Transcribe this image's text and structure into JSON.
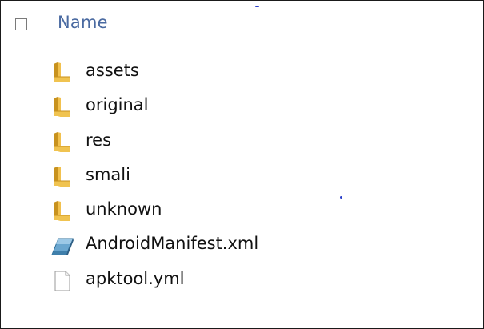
{
  "header": {
    "column_name": "Name"
  },
  "items": [
    {
      "name": "assets",
      "kind": "folder",
      "icon": "folder-icon"
    },
    {
      "name": "original",
      "kind": "folder",
      "icon": "folder-icon"
    },
    {
      "name": "res",
      "kind": "folder",
      "icon": "folder-icon"
    },
    {
      "name": "smali",
      "kind": "folder",
      "icon": "folder-icon"
    },
    {
      "name": "unknown",
      "kind": "folder",
      "icon": "folder-icon"
    },
    {
      "name": "AndroidManifest.xml",
      "kind": "xml",
      "icon": "xml-file-icon"
    },
    {
      "name": "apktool.yml",
      "kind": "file",
      "icon": "document-icon"
    }
  ],
  "colors": {
    "header_text": "#4a6aa1",
    "folder_yellow": "#e8b93a",
    "xml_blue": "#4a8bb5",
    "stray_dot": "#2b3fc9"
  }
}
